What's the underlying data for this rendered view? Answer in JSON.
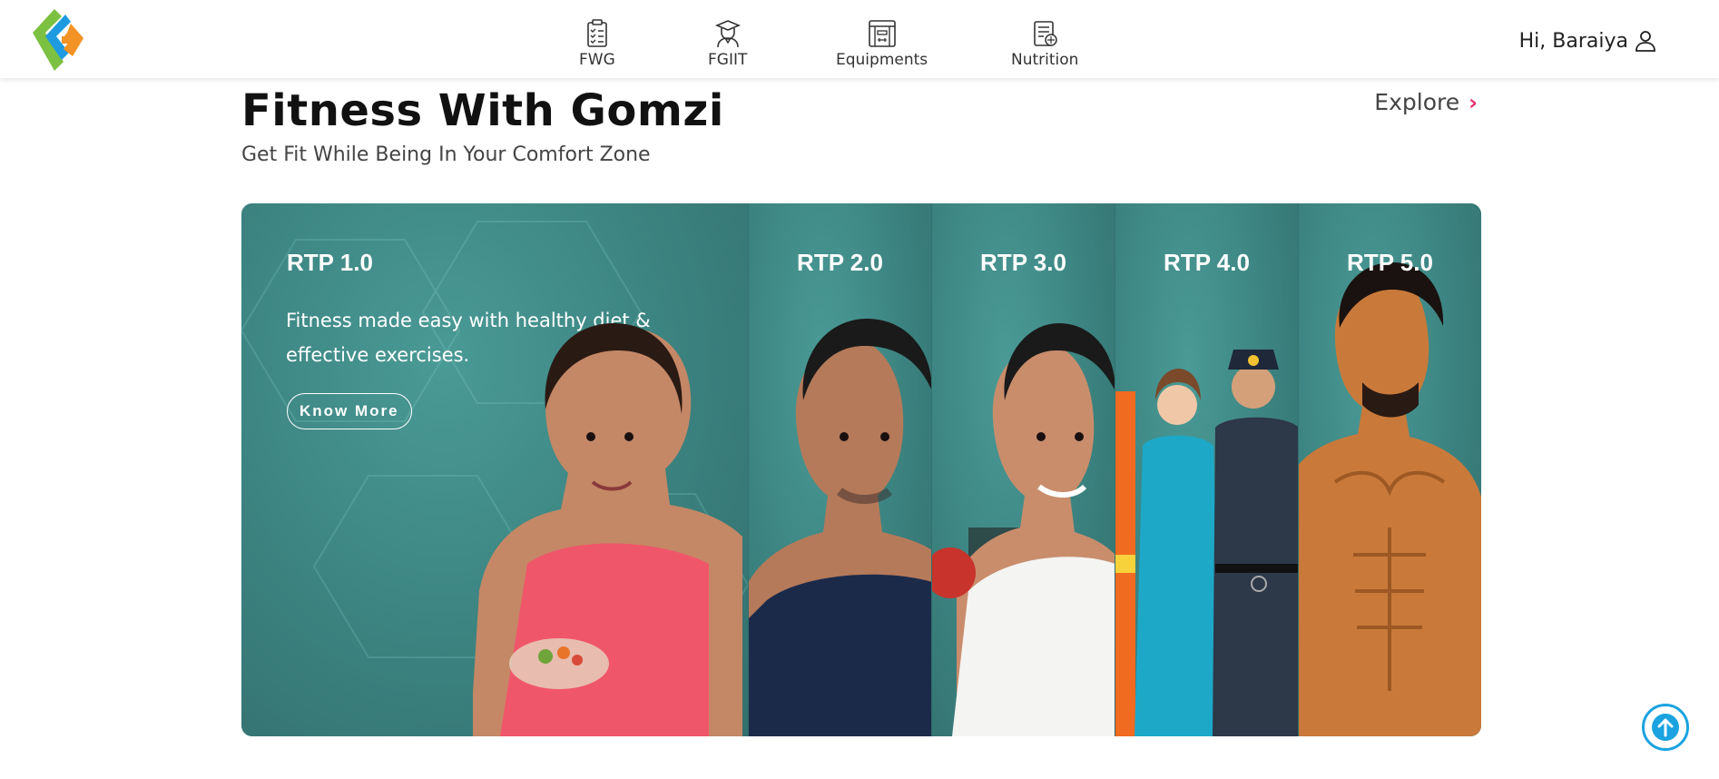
{
  "header": {
    "nav": [
      {
        "label": "FWG",
        "icon": "clipboard-checklist-icon"
      },
      {
        "label": "FGIIT",
        "icon": "graduate-icon"
      },
      {
        "label": "Equipments",
        "icon": "gym-equipment-icon"
      },
      {
        "label": "Nutrition",
        "icon": "nutrition-report-icon"
      }
    ],
    "user_greeting": "Hi, Baraiya",
    "user_icon": "user-icon"
  },
  "section": {
    "title": "Fitness With Gomzi",
    "subtitle": "Get Fit While Being In Your Comfort Zone",
    "explore_label": "Explore"
  },
  "carousel": {
    "panels": [
      {
        "title": "RTP 1.0",
        "description": "Fitness made easy with healthy diet & effective exercises.",
        "button": "Know More"
      },
      {
        "title": "RTP 2.0"
      },
      {
        "title": "RTP 3.0"
      },
      {
        "title": "RTP 4.0"
      },
      {
        "title": "RTP 5.0"
      }
    ]
  },
  "colors": {
    "teal": "#3f8784",
    "accent_pink": "#e6306b",
    "scroll_blue": "#1aa3e0",
    "logo_green": "#7cc142",
    "logo_blue": "#1e9be0",
    "logo_orange": "#f39325"
  }
}
